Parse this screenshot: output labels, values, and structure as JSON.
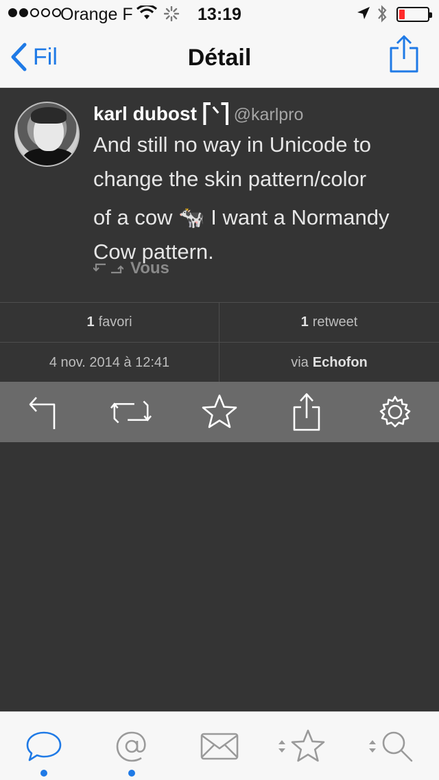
{
  "status": {
    "carrier": "Orange F",
    "time": "13:19",
    "battery_level": 0.2
  },
  "nav": {
    "back_label": "Fil",
    "title": "Détail",
    "share_icon": "share-icon"
  },
  "tweet": {
    "author_name": "karl dubost ⎡ᐠ⎤",
    "author_handle": "@karlpro",
    "text_line1": "And still no way in Unicode to",
    "text_line2": "change the skin pattern/color",
    "text_line3": "of a cow 🐄 I want a Normandy",
    "text_line4": "Cow pattern.",
    "retweeted_by": "Vous"
  },
  "stats": {
    "favorites_count": "1",
    "favorites_label": "favori",
    "retweets_count": "1",
    "retweets_label": "retweet",
    "date": "4 nov. 2014 à 12:41",
    "via_prefix": "via",
    "via_app": "Echofon"
  },
  "actions": [
    "reply-icon",
    "retweet-icon",
    "star-icon",
    "share-icon",
    "gear-icon"
  ],
  "tabs": [
    "timeline-tab",
    "mentions-tab",
    "messages-tab",
    "favorites-tab",
    "search-tab"
  ],
  "colors": {
    "accent": "#1f7ae6",
    "background": "#343434",
    "action_bar": "#6a6a6a",
    "battery_low": "#ff2a2a"
  }
}
